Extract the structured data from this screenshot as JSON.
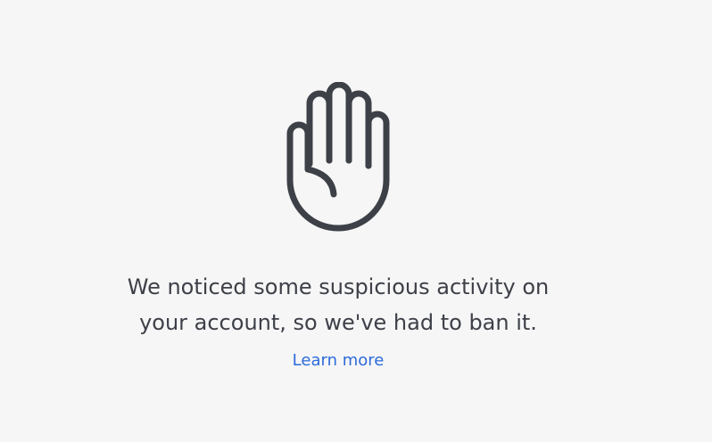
{
  "ban_notice": {
    "icon": "raised-hand-icon",
    "message_line_1": "We noticed some suspicious activity on",
    "message_line_2": "your account, so we've had to ban it.",
    "learn_more_label": "Learn more"
  },
  "colors": {
    "background": "#f6f6f7",
    "text": "#3e4048",
    "icon_stroke": "#3e4048",
    "link": "#2d6bd9"
  }
}
